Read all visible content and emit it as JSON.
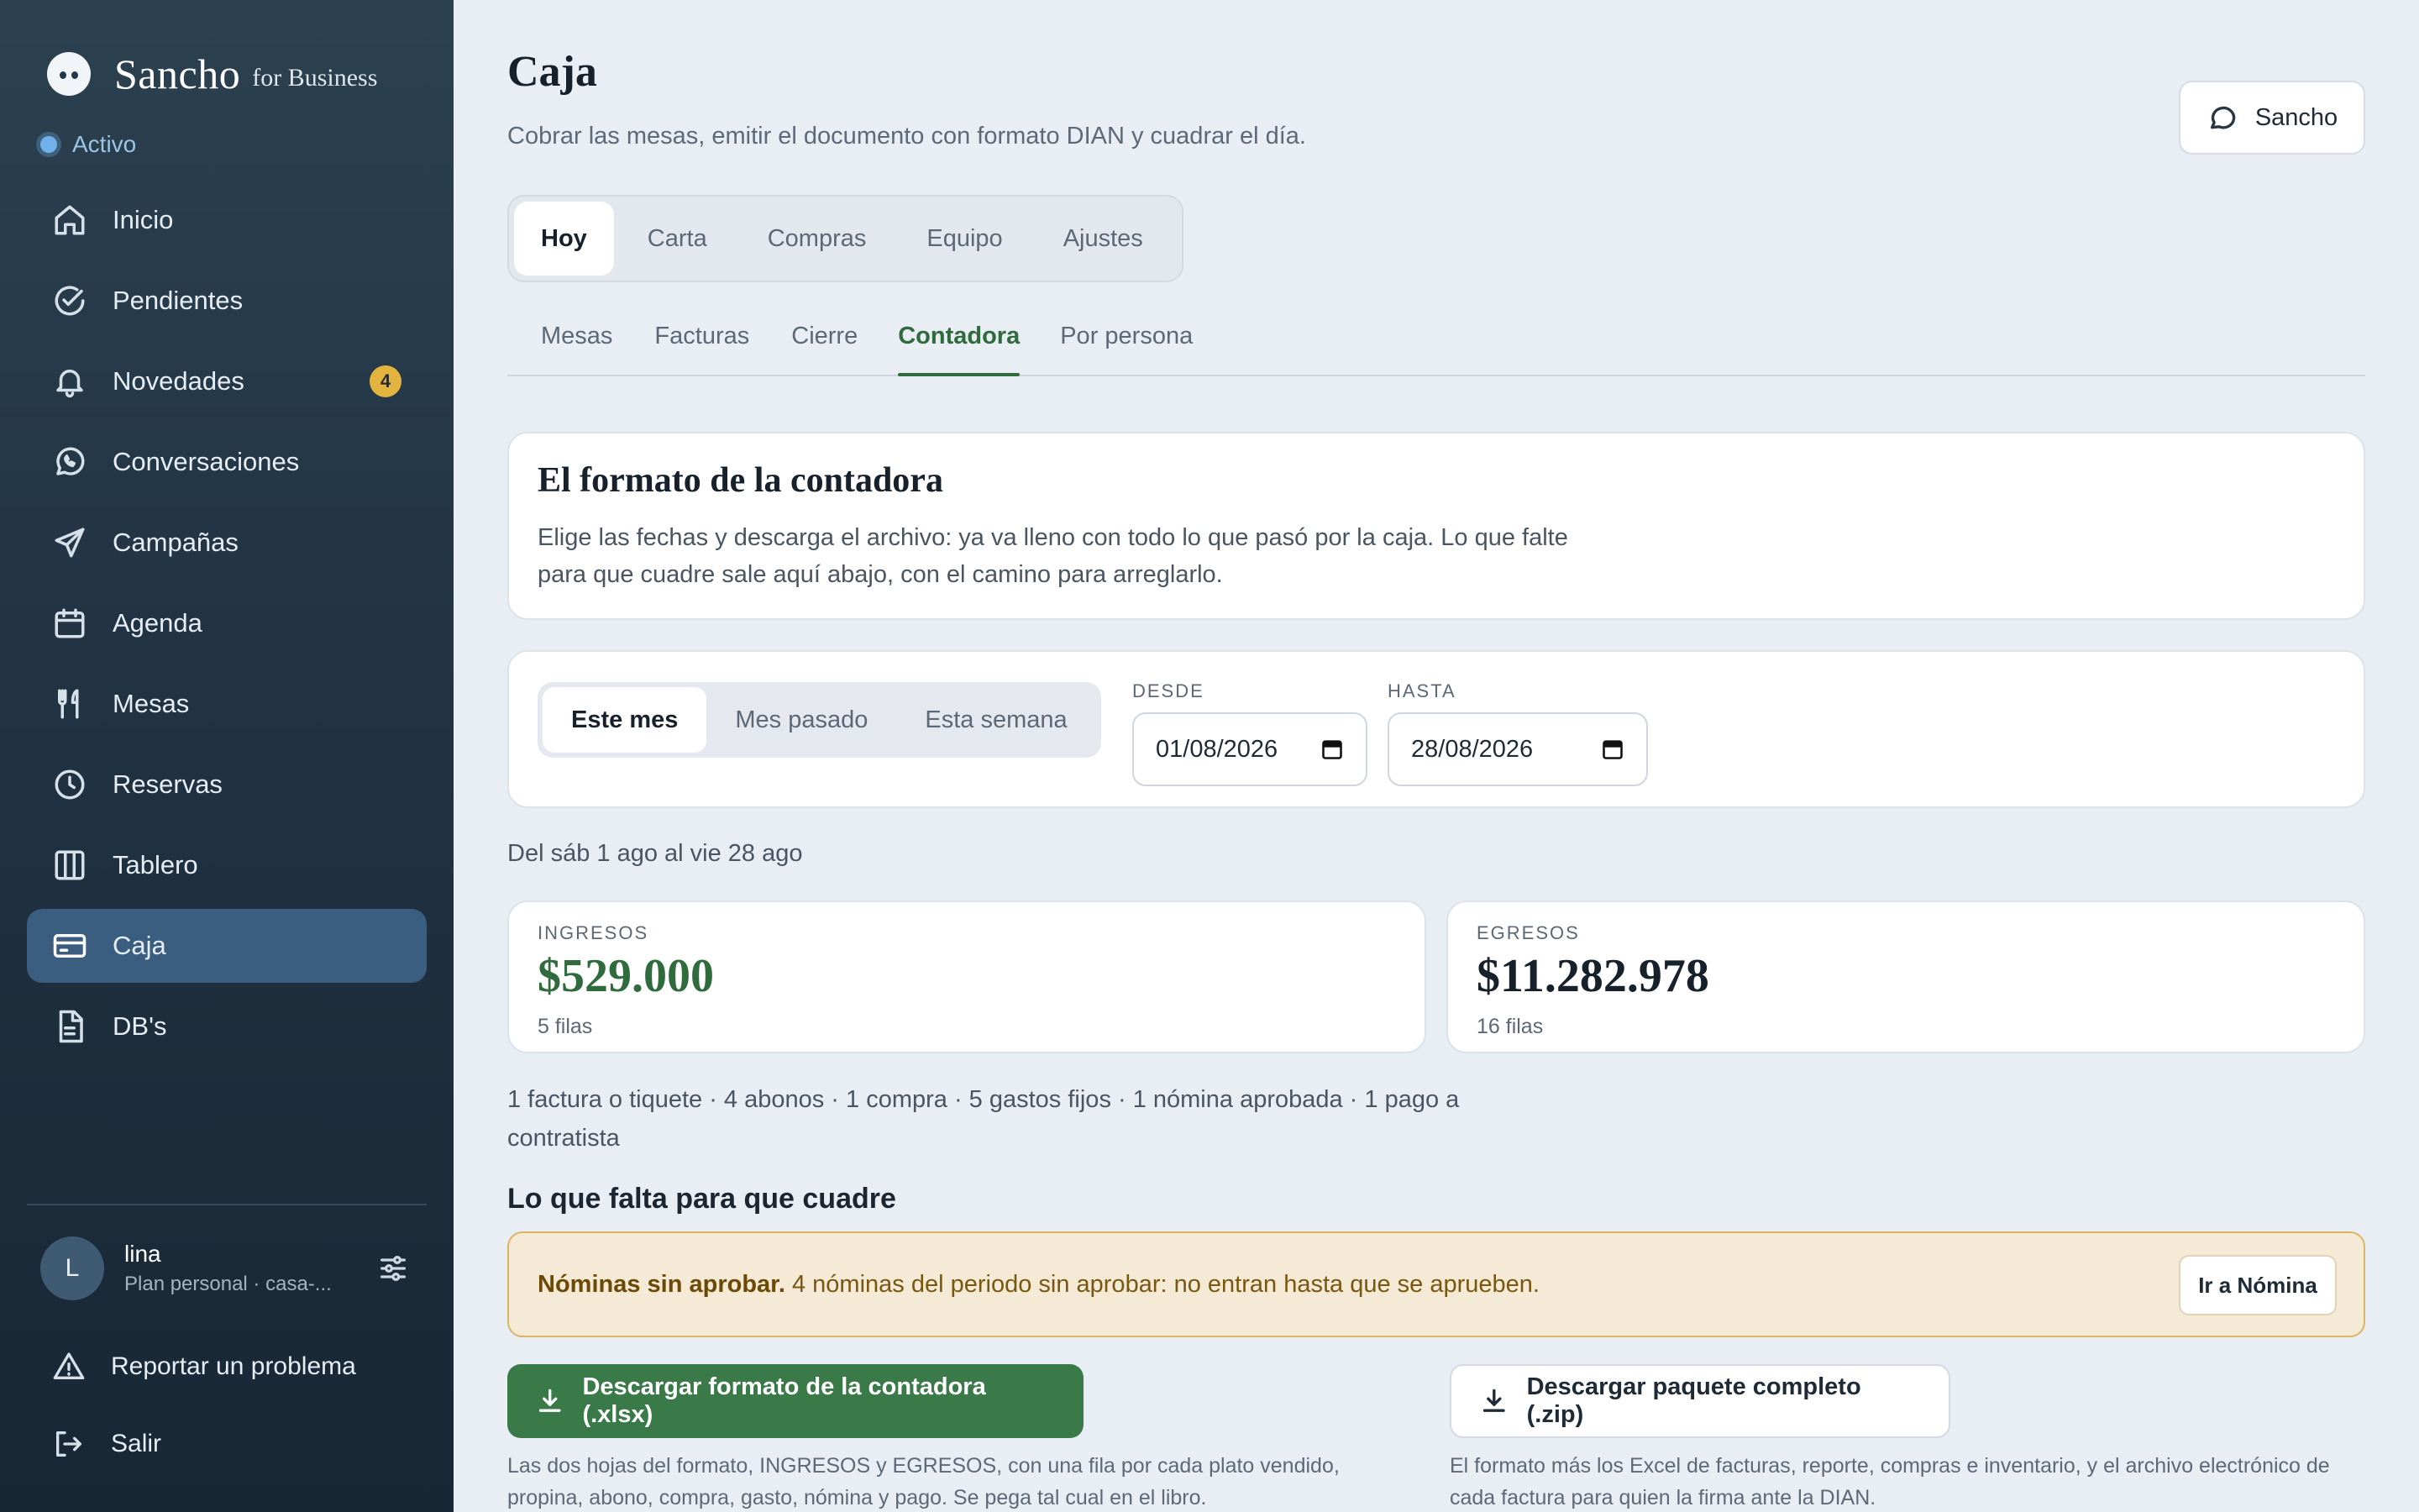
{
  "brand": {
    "name": "Sancho",
    "sub": "for Business"
  },
  "status": "Activo",
  "nav": [
    {
      "label": "Inicio",
      "icon": "home-icon"
    },
    {
      "label": "Pendientes",
      "icon": "check-circle-icon"
    },
    {
      "label": "Novedades",
      "icon": "bell-icon",
      "badge": "4"
    },
    {
      "label": "Conversaciones",
      "icon": "whatsapp-icon"
    },
    {
      "label": "Campañas",
      "icon": "send-icon"
    },
    {
      "label": "Agenda",
      "icon": "calendar-icon"
    },
    {
      "label": "Mesas",
      "icon": "utensils-icon"
    },
    {
      "label": "Reservas",
      "icon": "clock-icon"
    },
    {
      "label": "Tablero",
      "icon": "columns-icon"
    },
    {
      "label": "Caja",
      "icon": "credit-card-icon",
      "active": true
    },
    {
      "label": "DB's",
      "icon": "file-icon"
    }
  ],
  "user": {
    "initial": "L",
    "name": "lina",
    "plan": "Plan personal · casa-..."
  },
  "report_label": "Reportar un problema",
  "logout_label": "Salir",
  "header": {
    "title": "Caja",
    "subtitle": "Cobrar las mesas, emitir el documento con formato DIAN y cuadrar el día.",
    "assistant_button": "Sancho"
  },
  "tabs": [
    "Hoy",
    "Carta",
    "Compras",
    "Equipo",
    "Ajustes"
  ],
  "subtabs": [
    "Mesas",
    "Facturas",
    "Cierre",
    "Contadora",
    "Por persona"
  ],
  "intro": {
    "title": "El formato de la contadora",
    "text": "Elige las fechas y descarga el archivo: ya va lleno con todo lo que pasó por la caja. Lo que falte para que cuadre sale aquí abajo, con el camino para arreglarlo."
  },
  "range": {
    "presets": [
      "Este mes",
      "Mes pasado",
      "Esta semana"
    ],
    "from_label": "DESDE",
    "from_value": "01/08/2026",
    "to_label": "HASTA",
    "to_value": "28/08/2026"
  },
  "period_text": "Del sáb 1 ago al vie 28 ago",
  "ingresos": {
    "label": "INGRESOS",
    "value": "$529.000",
    "rows": "5 filas",
    "color": "#2f6b3c"
  },
  "egresos": {
    "label": "EGRESOS",
    "value": "$11.282.978",
    "rows": "16 filas",
    "color": "#16212c"
  },
  "summary": "1 factura o tiquete · 4 abonos · 1 compra · 5 gastos fijos · 1 nómina aprobada · 1 pago a contratista",
  "missing_title": "Lo que falta para que cuadre",
  "alert": {
    "title": "Nóminas sin aprobar.",
    "text": " 4 nóminas del periodo sin aprobar: no entran hasta que se aprueben.",
    "button": "Ir a Nómina"
  },
  "downloads": {
    "primary_label": "Descargar formato de la contadora (.xlsx)",
    "primary_note": "Las dos hojas del formato, INGRESOS y EGRESOS, con una fila por cada plato vendido, propina, abono, compra, gasto, nómina y pago. Se pega tal cual en el libro.",
    "secondary_label": "Descargar paquete completo (.zip)",
    "secondary_note": "El formato más los Excel de facturas, reporte, compras e inventario, y el archivo electrónico de cada factura para quien la firma ante la DIAN."
  }
}
